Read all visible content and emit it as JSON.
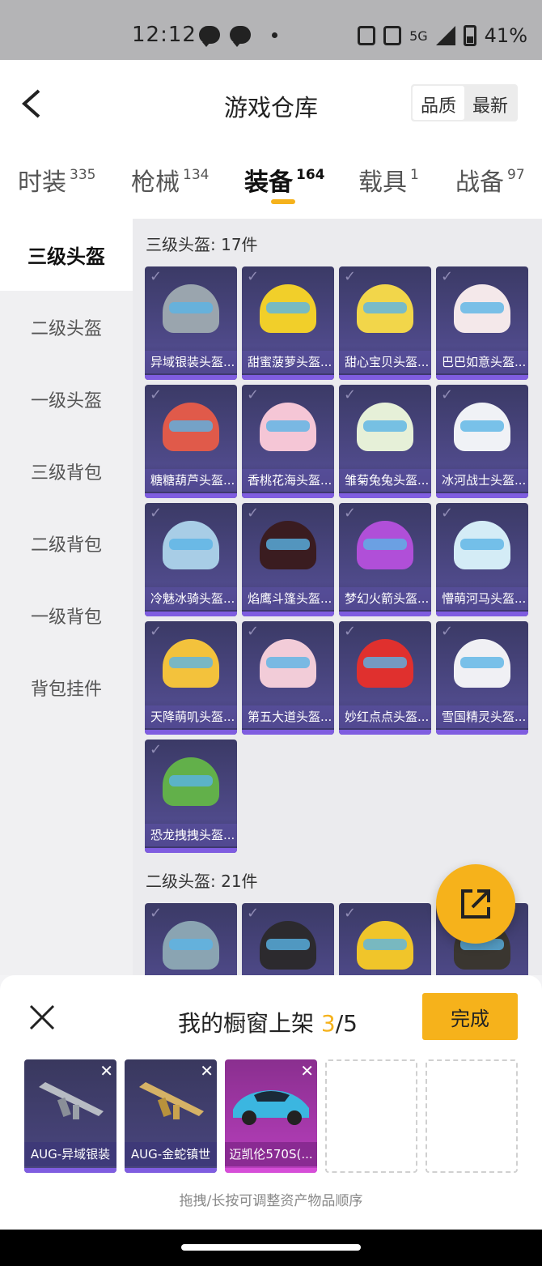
{
  "status_bar": {
    "time": "12:12",
    "network": "5G",
    "battery": "41%"
  },
  "header": {
    "title": "游戏仓库",
    "sort_options": [
      "品质",
      "最新"
    ],
    "sort_active": "品质"
  },
  "tabs": [
    {
      "label": "时装",
      "count": "335"
    },
    {
      "label": "枪械",
      "count": "134"
    },
    {
      "label": "装备",
      "count": "164",
      "active": true
    },
    {
      "label": "载具",
      "count": "1"
    },
    {
      "label": "战备",
      "count": "97"
    }
  ],
  "sidebar": [
    {
      "label": "三级头盔",
      "active": true
    },
    {
      "label": "二级头盔"
    },
    {
      "label": "一级头盔"
    },
    {
      "label": "三级背包"
    },
    {
      "label": "二级背包"
    },
    {
      "label": "一级背包"
    },
    {
      "label": "背包挂件"
    }
  ],
  "sections": [
    {
      "title": "三级头盔: 17件",
      "items": [
        {
          "name": "异域银装头盔...",
          "color": "#9aa5ae"
        },
        {
          "name": "甜蜜菠萝头盔...",
          "color": "#f1cf2a"
        },
        {
          "name": "甜心宝贝头盔...",
          "color": "#f2d64a"
        },
        {
          "name": "巴巴如意头盔...",
          "color": "#f4e8ea"
        },
        {
          "name": "糖糖葫芦头盔...",
          "color": "#e05a4a"
        },
        {
          "name": "香桃花海头盔...",
          "color": "#f5c6d6"
        },
        {
          "name": "雏菊兔兔头盔...",
          "color": "#e6f0d8"
        },
        {
          "name": "冰河战士头盔...",
          "color": "#f0f2f6"
        },
        {
          "name": "冷魅冰骑头盔...",
          "color": "#a8cde6"
        },
        {
          "name": "焰鹰斗篷头盔...",
          "color": "#3a1c20"
        },
        {
          "name": "梦幻火箭头盔...",
          "color": "#b04fd8"
        },
        {
          "name": "懵萌河马头盔...",
          "color": "#d4ecf6"
        },
        {
          "name": "天降萌叽头盔...",
          "color": "#f3c23c"
        },
        {
          "name": "第五大道头盔...",
          "color": "#f2ccd8"
        },
        {
          "name": "妙红点点头盔...",
          "color": "#e0302e"
        },
        {
          "name": "雪国精灵头盔...",
          "color": "#f0f0f4"
        },
        {
          "name": "恐龙拽拽头盔...",
          "color": "#62b04a"
        }
      ]
    },
    {
      "title": "二级头盔: 21件",
      "items": [
        {
          "name": "",
          "color": "#8aa4b2"
        },
        {
          "name": "",
          "color": "#2c2a2e"
        },
        {
          "name": "",
          "color": "#f0c52a"
        },
        {
          "name": "",
          "color": "#3a3630"
        }
      ]
    }
  ],
  "showcase": {
    "title_prefix": "我的橱窗上架 ",
    "count_current": "3",
    "count_total": "/5",
    "done_label": "完成",
    "slots": [
      {
        "name": "AUG-异域银装",
        "type": "weapon"
      },
      {
        "name": "AUG-金蛇镇世",
        "type": "weapon"
      },
      {
        "name": "迈凯伦570S(...",
        "type": "car"
      }
    ],
    "hint": "拖拽/长按可调整资产物品顺序"
  }
}
